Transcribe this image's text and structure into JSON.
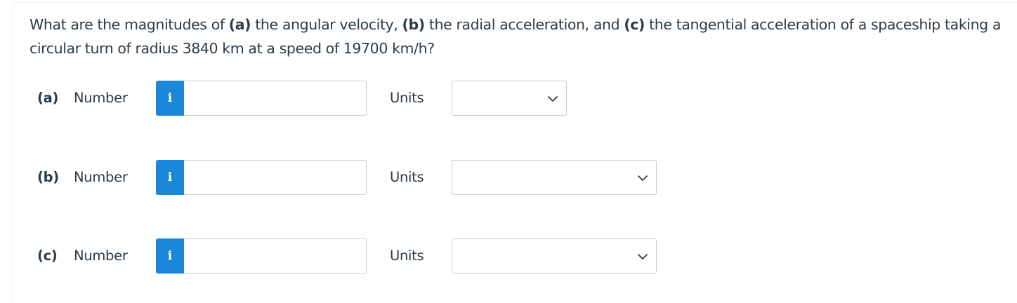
{
  "question": {
    "text_1": "What are the magnitudes of ",
    "part_a": "(a)",
    "text_2": " the angular velocity, ",
    "part_b": "(b)",
    "text_3": " the radial acceleration, and ",
    "part_c": "(c)",
    "text_4": " the tangential acceleration of a spaceship taking a circular turn of radius 3840 km at a speed of 19700 km/h?"
  },
  "rows": [
    {
      "part_label": "(a)",
      "number_label": "Number",
      "info_icon": "info-icon",
      "info_glyph": "i",
      "number_value": "",
      "units_label": "Units",
      "units_value": ""
    },
    {
      "part_label": "(b)",
      "number_label": "Number",
      "info_icon": "info-icon",
      "info_glyph": "i",
      "number_value": "",
      "units_label": "Units",
      "units_value": ""
    },
    {
      "part_label": "(c)",
      "number_label": "Number",
      "info_icon": "info-icon",
      "info_glyph": "i",
      "number_value": "",
      "units_label": "Units",
      "units_value": ""
    }
  ],
  "colors": {
    "info_button": "#1a87d8",
    "text": "#2d3b45",
    "border": "#c7cdd1"
  },
  "icons": {
    "dropdown": "chevron-down-icon"
  }
}
